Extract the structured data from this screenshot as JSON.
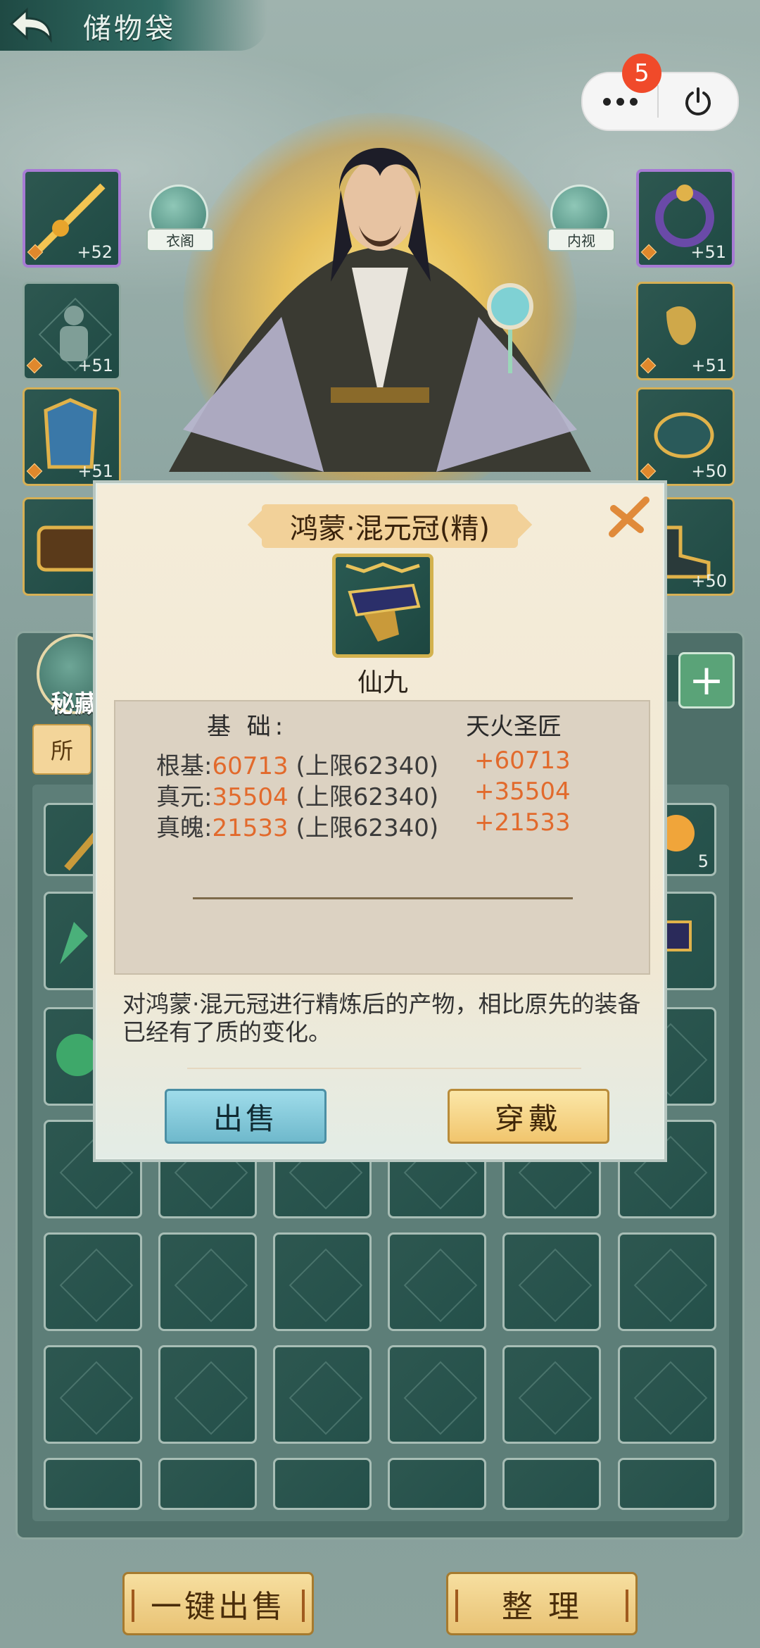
{
  "header": {
    "title": "储物袋"
  },
  "miniprogram": {
    "badge_count": "5"
  },
  "character": {
    "wardrobe_label": "衣阁",
    "inspect_label": "内视"
  },
  "equip_left": [
    {
      "level": "+52"
    },
    {
      "level": "+51"
    },
    {
      "level": "+51"
    },
    {
      "level": "+"
    }
  ],
  "equip_right": [
    {
      "level": "+51"
    },
    {
      "level": "+51"
    },
    {
      "level": "+50"
    },
    {
      "level": "+50"
    }
  ],
  "bag": {
    "treasure_label": "秘藏",
    "tab_all": "所",
    "visible_qty": "5"
  },
  "modal": {
    "title": "鸿蒙·混元冠(精)",
    "grade": "仙九",
    "header_base": "基 础:",
    "header_bonus": "天火圣匠",
    "stats": [
      {
        "name": "根基:",
        "value": "60713",
        "limit": " (上限62340)",
        "bonus": "+60713"
      },
      {
        "name": "真元:",
        "value": "35504",
        "limit": " (上限62340)",
        "bonus": "+35504"
      },
      {
        "name": "真魄:",
        "value": "21533",
        "limit": " (上限62340)",
        "bonus": "+21533"
      }
    ],
    "description": "对鸿蒙·混元冠进行精炼后的产物，相比原先的装备已经有了质的变化。",
    "sell_label": "出售",
    "wear_label": "穿戴"
  },
  "footer": {
    "sell_all": "一键出售",
    "arrange": "整 理"
  },
  "colors": {
    "accent_orange": "#e26a2c",
    "gold_border": "#d3b24e",
    "teal_panel": "#2d5750",
    "badge_red": "#f04a2a"
  }
}
